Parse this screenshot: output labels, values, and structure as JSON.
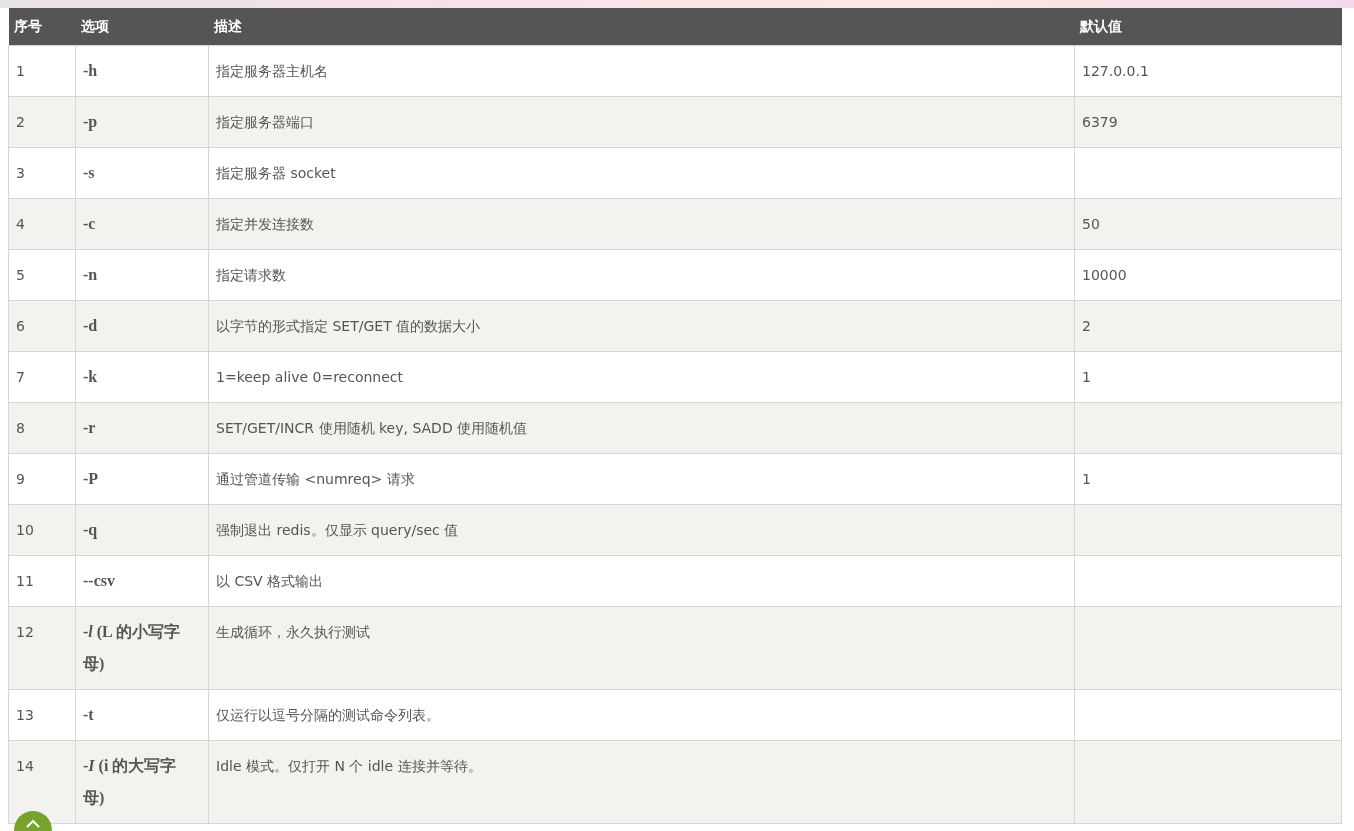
{
  "table": {
    "columns": [
      "序号",
      "选项",
      "描述",
      "默认值"
    ],
    "rows": [
      {
        "index": "1",
        "option": "-h",
        "description": "指定服务器主机名",
        "default": "127.0.0.1"
      },
      {
        "index": "2",
        "option": "-p",
        "description": "指定服务器端口",
        "default": "6379"
      },
      {
        "index": "3",
        "option": "-s",
        "description": "指定服务器 socket"
      },
      {
        "index": "4",
        "option": "-c",
        "description": "指定并发连接数",
        "default": "50"
      },
      {
        "index": "5",
        "option": "-n",
        "description": "指定请求数",
        "default": "10000"
      },
      {
        "index": "6",
        "option": "-d",
        "description": "以字节的形式指定 SET/GET 值的数据大小",
        "default": "2"
      },
      {
        "index": "7",
        "option": "-k",
        "description": "1=keep alive 0=reconnect",
        "default": "1"
      },
      {
        "index": "8",
        "option": "-r",
        "description": "SET/GET/INCR 使用随机 key, SADD 使用随机值"
      },
      {
        "index": "9",
        "option": "-P",
        "description": "通过管道传输 <numreq> 请求",
        "default": "1"
      },
      {
        "index": "10",
        "option": "-q",
        "description": "强制退出 redis。仅显示 query/sec 值"
      },
      {
        "index": "11",
        "option": "--csv",
        "description": "以 CSV 格式输出"
      },
      {
        "index": "12",
        "option": "-*l* (L 的小写字母)",
        "description": "生成循环，永久执行测试"
      },
      {
        "index": "13",
        "option": "-t",
        "description": "仅运行以逗号分隔的测试命令列表。"
      },
      {
        "index": "14",
        "option": "-*I* (i 的大写字母)",
        "description": "Idle 模式。仅打开 N 个 idle 连接并等待。"
      }
    ]
  }
}
